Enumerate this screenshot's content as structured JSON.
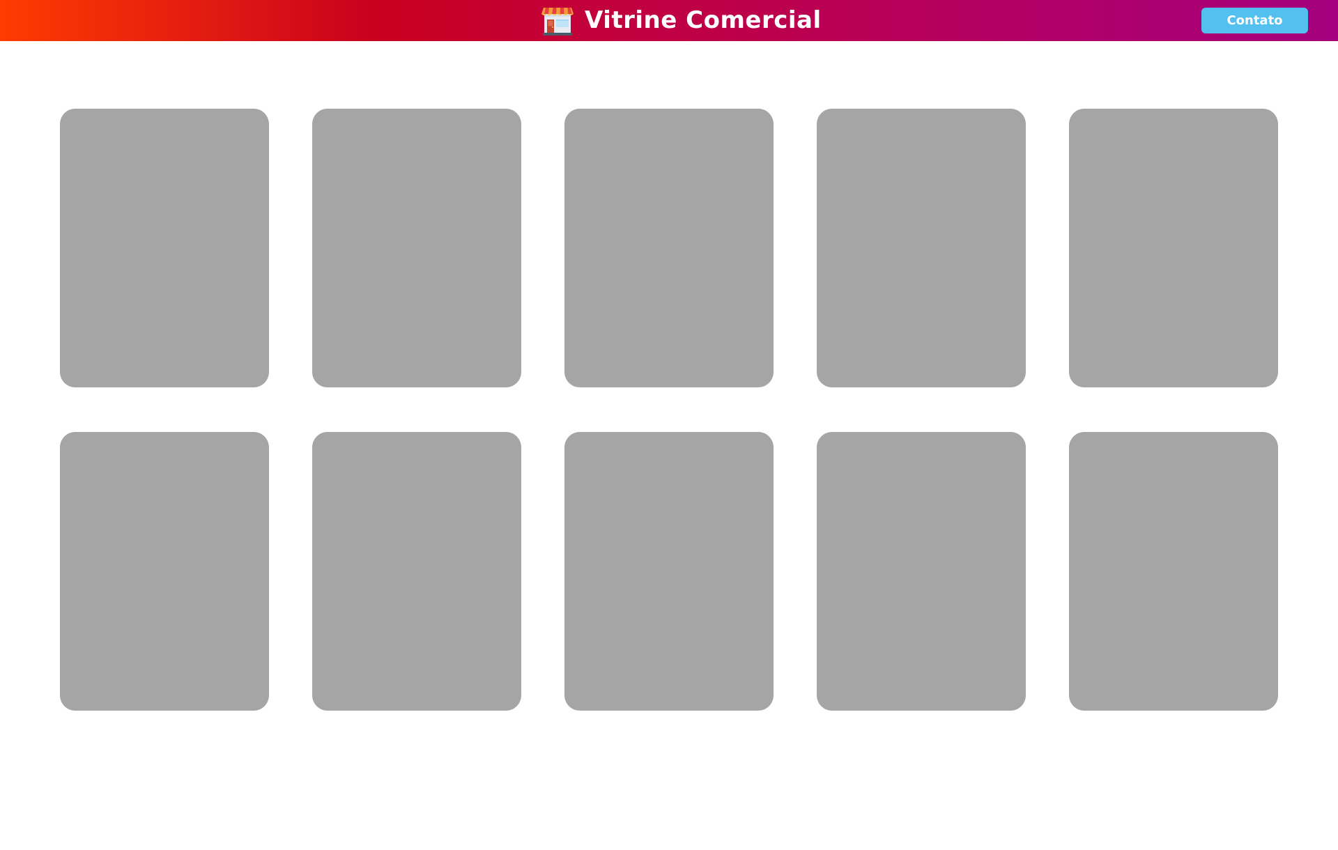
{
  "header": {
    "title": "Vitrine Comercial",
    "logo_icon": "store-icon",
    "contact_label": "Contato",
    "gradient_colors": [
      "#ff3c00",
      "#c8001e",
      "#c2003c",
      "#b0006a",
      "#a4007e"
    ],
    "contact_color": "#53c0ef"
  },
  "products": {
    "placeholder_color": "#a5a5a5",
    "items": [
      {
        "state": "loading"
      },
      {
        "state": "loading"
      },
      {
        "state": "loading"
      },
      {
        "state": "loading"
      },
      {
        "state": "loading"
      },
      {
        "state": "loading"
      },
      {
        "state": "loading"
      },
      {
        "state": "loading"
      },
      {
        "state": "loading"
      },
      {
        "state": "loading"
      }
    ]
  }
}
